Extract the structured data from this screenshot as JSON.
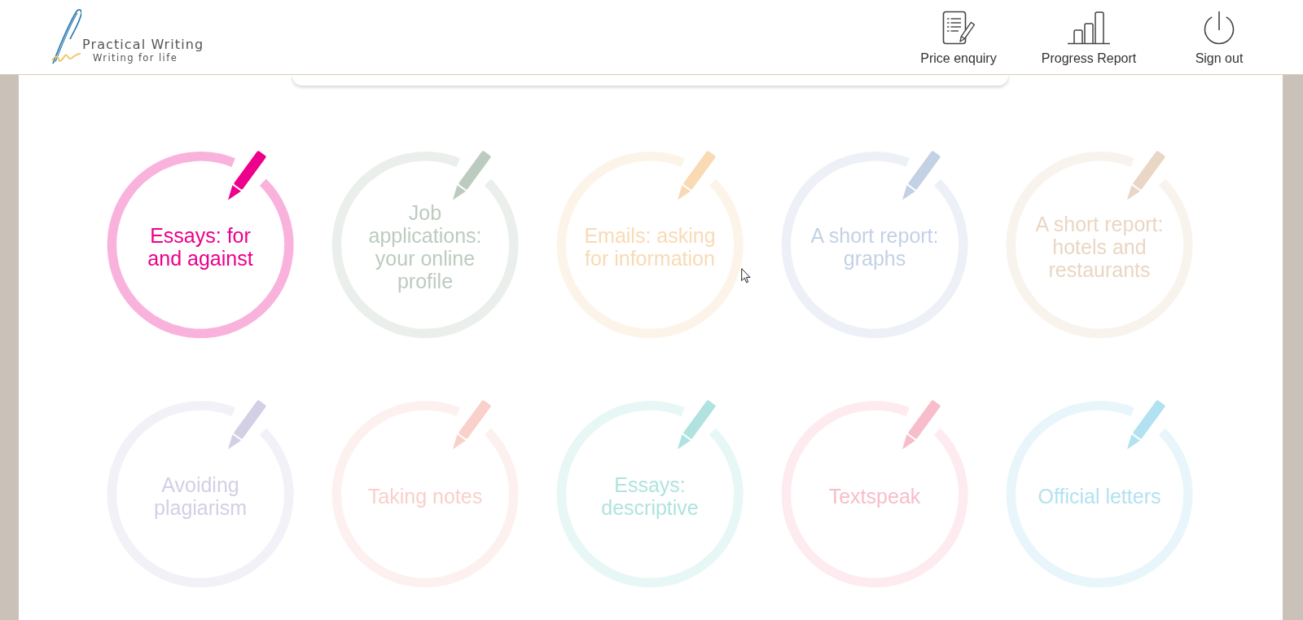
{
  "header": {
    "logo": {
      "name": "Practical Writing",
      "tagline": "Writing for life"
    },
    "nav": [
      {
        "label": "Price enquiry"
      },
      {
        "label": "Progress Report"
      },
      {
        "label": "Sign out"
      }
    ]
  },
  "topics": [
    {
      "title": "Essays: for and against",
      "color": "#ec008c"
    },
    {
      "title": "Job applications: your online profile",
      "color": "#bccbbf"
    },
    {
      "title": "Emails: asking for information",
      "color": "#f9dab5"
    },
    {
      "title": "A short report: graphs",
      "color": "#c3d1e5"
    },
    {
      "title": "A short report: hotels and restaurants",
      "color": "#ead6c4"
    },
    {
      "title": "Avoiding plagiarism",
      "color": "#d3cfe5"
    },
    {
      "title": "Taking notes",
      "color": "#f9d0ca"
    },
    {
      "title": "Essays: descriptive",
      "color": "#b0e3df"
    },
    {
      "title": "Textspeak",
      "color": "#f7bdca"
    },
    {
      "title": "Official letters",
      "color": "#b2e2f1"
    }
  ]
}
